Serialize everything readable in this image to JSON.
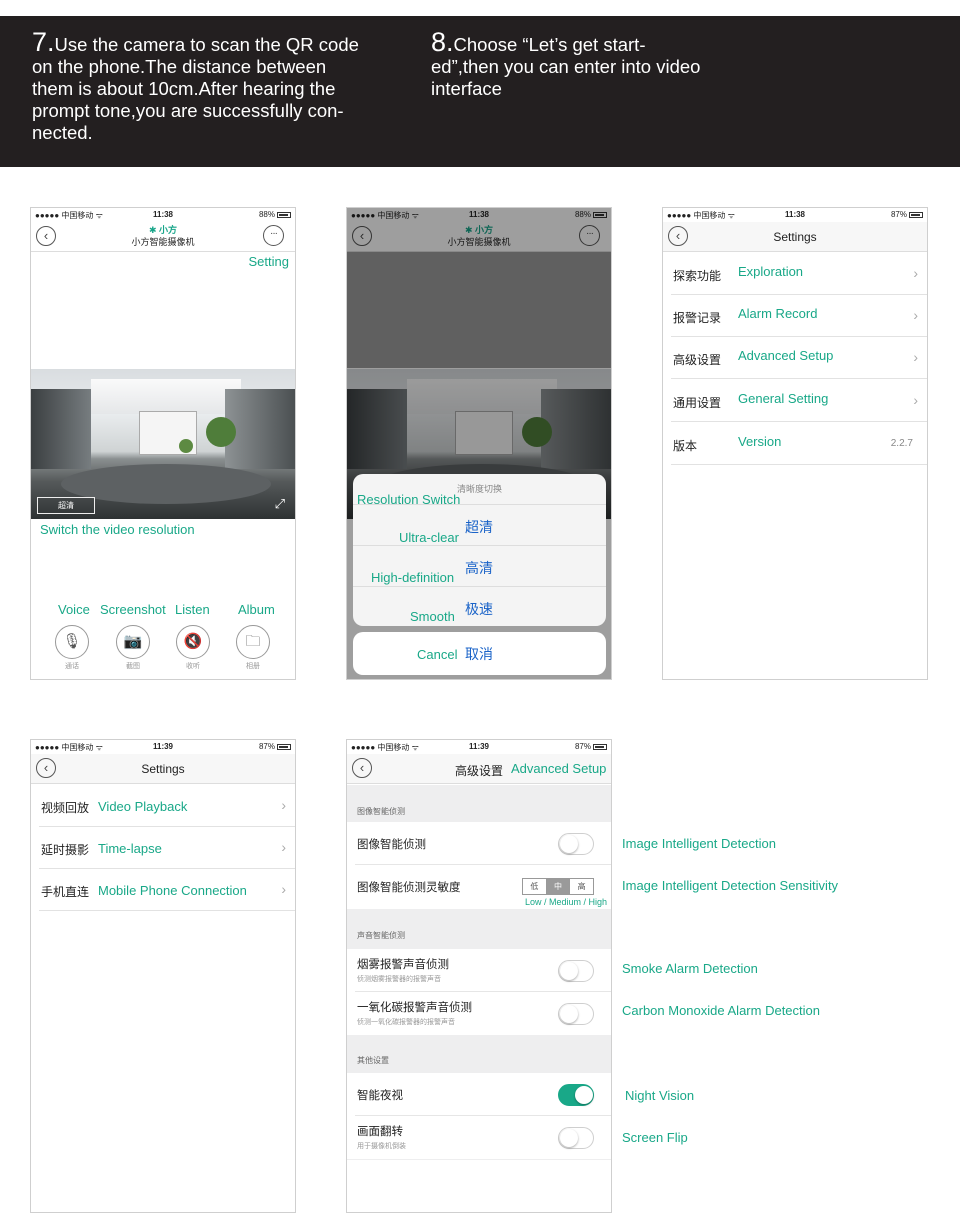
{
  "header": {
    "step7_num": "7.",
    "step7_text": "Use the camera to scan the QR code on the phone.The distance between them is about 10cm.After hearing the prompt tone,you are successfully con-nected.",
    "step8_num": "8.",
    "step8_text": "Choose “Let’s get start-ed”,then you can enter into video interface"
  },
  "status": {
    "carrier": "●●●●● 中国移动 ᯤ",
    "time_a": "11:38",
    "time_b": "11:39",
    "battery_a": "88%",
    "battery_b": "87%"
  },
  "colors": {
    "accent": "#19a888",
    "dark_header": "#231f20",
    "link_blue": "#1a63c8"
  },
  "screen1": {
    "brand": "✱ 小方",
    "subtitle": "小方智能摄像机",
    "back_icon": "‹",
    "more_icon": "···",
    "setting_label": "Setting",
    "resolution_button": "超清",
    "fullscreen_icon": "⤢",
    "switch_caption": "Switch the video resolution",
    "tools": [
      {
        "en": "Voice",
        "cn": "通话",
        "icon": "microphone-icon",
        "glyph": "🎙"
      },
      {
        "en": "Screenshot",
        "cn": "截图",
        "icon": "camera-icon",
        "glyph": "📷"
      },
      {
        "en": "Listen",
        "cn": "收听",
        "icon": "speaker-mute-icon",
        "glyph": "🔇"
      },
      {
        "en": "Album",
        "cn": "相册",
        "icon": "folder-icon",
        "glyph": "🗀"
      }
    ]
  },
  "screen2": {
    "brand": "✱ 小方",
    "subtitle": "小方智能摄像机",
    "sheet_title": "清晰度切换",
    "sheet_title_en": "Resolution Switch",
    "options": [
      {
        "cn": "超清",
        "en": "Ultra-clear"
      },
      {
        "cn": "高清",
        "en": "High-definition"
      },
      {
        "cn": "极速",
        "en": "Smooth"
      }
    ],
    "cancel_cn": "取消",
    "cancel_en": "Cancel"
  },
  "screen3": {
    "title": "Settings",
    "rows": [
      {
        "cn": "探索功能",
        "en": "Exploration",
        "chevron": "›"
      },
      {
        "cn": "报警记录",
        "en": "Alarm Record",
        "chevron": "›"
      },
      {
        "cn": "高级设置",
        "en": "Advanced Setup",
        "chevron": "›"
      },
      {
        "cn": "通用设置",
        "en": "General Setting",
        "chevron": "›"
      },
      {
        "cn": "版本",
        "en": "Version",
        "value": "2.2.7"
      }
    ]
  },
  "screen4": {
    "title": "Settings",
    "rows": [
      {
        "cn": "视频回放",
        "en": "Video Playback",
        "chevron": "›"
      },
      {
        "cn": "延时摄影",
        "en": "Time-lapse",
        "chevron": "›"
      },
      {
        "cn": "手机直连",
        "en": "Mobile Phone Connection",
        "chevron": "›"
      }
    ]
  },
  "screen5": {
    "title_cn": "高级设置",
    "title_en": "Advanced Setup",
    "section1": "图像智能侦测",
    "image_detection": {
      "cn": "图像智能侦测",
      "on": false
    },
    "sensitivity": {
      "cn": "图像智能侦测灵敏度",
      "options": [
        "低",
        "中",
        "高"
      ],
      "selected": "中",
      "hint": "Low / Medium / High"
    },
    "section2": "声音智能侦测",
    "smoke": {
      "cn": "烟雾报警声音侦测",
      "sub": "侦测烟雾报警器的报警声音",
      "on": false
    },
    "co": {
      "cn": "一氧化碳报警声音侦测",
      "sub": "侦测一氧化碳报警器的报警声音",
      "on": false
    },
    "section3": "其他设置",
    "night": {
      "cn": "智能夜视",
      "on": true
    },
    "flip": {
      "cn": "画面翻转",
      "sub": "用于摄像机倒装",
      "on": false
    }
  },
  "annotations": {
    "image_detection": "Image Intelligent Detection",
    "sensitivity": "Image Intelligent Detection Sensitivity",
    "smoke": "Smoke Alarm Detection",
    "co": "Carbon Monoxide Alarm Detection",
    "night": "Night Vision",
    "flip": "Screen Flip"
  }
}
